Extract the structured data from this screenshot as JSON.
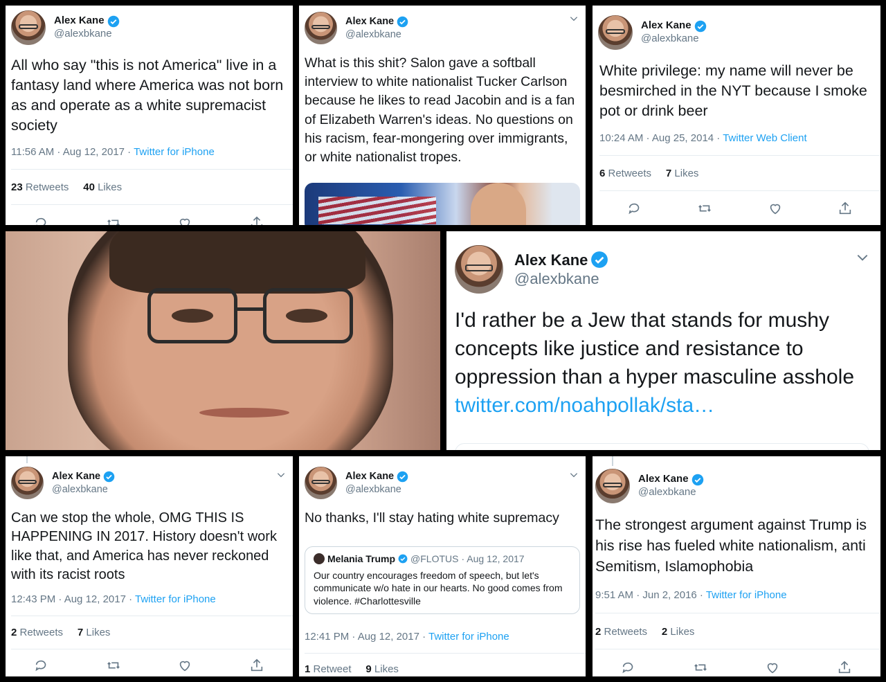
{
  "author": {
    "name": "Alex Kane",
    "handle": "@alexbkane"
  },
  "tweets": [
    {
      "text": "All who say \"this is not America\" live in a fantasy land where America was not born as and operate as a white supremacist society",
      "time": "11:56 AM · Aug 12, 2017 · ",
      "source": "Twitter for iPhone",
      "retweets": "23",
      "retweets_label": " Retweets",
      "likes": "40",
      "likes_label": " Likes"
    },
    {
      "text": "What is this shit? Salon gave a softball interview to white nationalist Tucker Carlson because he likes to read Jacobin and is a fan of Elizabeth Warren's ideas. No questions on his racism, fear-mongering over immigrants, or white nationalist tropes."
    },
    {
      "text": "White privilege: my name will never be besmirched in the NYT because I smoke pot or drink beer",
      "time": "10:24 AM · Aug 25, 2014 · ",
      "source": "Twitter Web Client",
      "retweets": "6",
      "retweets_label": " Retweets",
      "likes": "7",
      "likes_label": " Likes"
    },
    {
      "text": "I'd rather be a Jew that stands for mushy concepts like justice and resistance to oppression than a hyper masculine asshole",
      "link": "twitter.com/noahpollak/sta…"
    },
    {
      "text": "Can we stop the whole, OMG THIS IS HAPPENING IN 2017. History doesn't work like that, and America has never reckoned with its racist roots",
      "time": "12:43 PM · Aug 12, 2017 · ",
      "source": "Twitter for iPhone",
      "retweets": "2",
      "retweets_label": " Retweets",
      "likes": "7",
      "likes_label": " Likes"
    },
    {
      "text": "No thanks, I'll stay hating white supremacy",
      "quote": {
        "name": "Melania Trump",
        "handle": "@FLOTUS",
        "date": "· Aug 12, 2017",
        "text": "Our country encourages freedom of speech, but let's communicate w/o hate in our hearts. No good comes from violence. #Charlottesville"
      },
      "time": "12:41 PM · Aug 12, 2017 · ",
      "source": "Twitter for iPhone",
      "retweets": "1",
      "retweets_label": " Retweet",
      "likes": "9",
      "likes_label": " Likes"
    },
    {
      "text": "The strongest argument against Trump is his rise has fueled white nationalism, anti Semitism, Islamophobia",
      "time": "9:51 AM · Jun 2, 2016 · ",
      "source": "Twitter for iPhone",
      "retweets": "2",
      "retweets_label": " Retweets",
      "likes": "2",
      "likes_label": " Likes"
    }
  ],
  "colors": {
    "link": "#1da1f2",
    "muted": "#657786",
    "text": "#14171a",
    "border": "#e6ecf0"
  }
}
